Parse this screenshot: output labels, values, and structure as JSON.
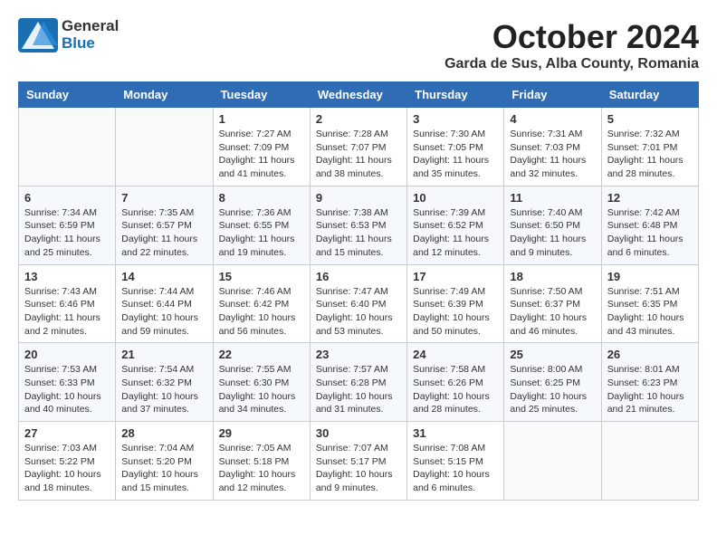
{
  "header": {
    "logo_general": "General",
    "logo_blue": "Blue",
    "month_title": "October 2024",
    "location": "Garda de Sus, Alba County, Romania"
  },
  "days_of_week": [
    "Sunday",
    "Monday",
    "Tuesday",
    "Wednesday",
    "Thursday",
    "Friday",
    "Saturday"
  ],
  "weeks": [
    [
      {
        "day": "",
        "details": ""
      },
      {
        "day": "",
        "details": ""
      },
      {
        "day": "1",
        "details": "Sunrise: 7:27 AM\nSunset: 7:09 PM\nDaylight: 11 hours and 41 minutes."
      },
      {
        "day": "2",
        "details": "Sunrise: 7:28 AM\nSunset: 7:07 PM\nDaylight: 11 hours and 38 minutes."
      },
      {
        "day": "3",
        "details": "Sunrise: 7:30 AM\nSunset: 7:05 PM\nDaylight: 11 hours and 35 minutes."
      },
      {
        "day": "4",
        "details": "Sunrise: 7:31 AM\nSunset: 7:03 PM\nDaylight: 11 hours and 32 minutes."
      },
      {
        "day": "5",
        "details": "Sunrise: 7:32 AM\nSunset: 7:01 PM\nDaylight: 11 hours and 28 minutes."
      }
    ],
    [
      {
        "day": "6",
        "details": "Sunrise: 7:34 AM\nSunset: 6:59 PM\nDaylight: 11 hours and 25 minutes."
      },
      {
        "day": "7",
        "details": "Sunrise: 7:35 AM\nSunset: 6:57 PM\nDaylight: 11 hours and 22 minutes."
      },
      {
        "day": "8",
        "details": "Sunrise: 7:36 AM\nSunset: 6:55 PM\nDaylight: 11 hours and 19 minutes."
      },
      {
        "day": "9",
        "details": "Sunrise: 7:38 AM\nSunset: 6:53 PM\nDaylight: 11 hours and 15 minutes."
      },
      {
        "day": "10",
        "details": "Sunrise: 7:39 AM\nSunset: 6:52 PM\nDaylight: 11 hours and 12 minutes."
      },
      {
        "day": "11",
        "details": "Sunrise: 7:40 AM\nSunset: 6:50 PM\nDaylight: 11 hours and 9 minutes."
      },
      {
        "day": "12",
        "details": "Sunrise: 7:42 AM\nSunset: 6:48 PM\nDaylight: 11 hours and 6 minutes."
      }
    ],
    [
      {
        "day": "13",
        "details": "Sunrise: 7:43 AM\nSunset: 6:46 PM\nDaylight: 11 hours and 2 minutes."
      },
      {
        "day": "14",
        "details": "Sunrise: 7:44 AM\nSunset: 6:44 PM\nDaylight: 10 hours and 59 minutes."
      },
      {
        "day": "15",
        "details": "Sunrise: 7:46 AM\nSunset: 6:42 PM\nDaylight: 10 hours and 56 minutes."
      },
      {
        "day": "16",
        "details": "Sunrise: 7:47 AM\nSunset: 6:40 PM\nDaylight: 10 hours and 53 minutes."
      },
      {
        "day": "17",
        "details": "Sunrise: 7:49 AM\nSunset: 6:39 PM\nDaylight: 10 hours and 50 minutes."
      },
      {
        "day": "18",
        "details": "Sunrise: 7:50 AM\nSunset: 6:37 PM\nDaylight: 10 hours and 46 minutes."
      },
      {
        "day": "19",
        "details": "Sunrise: 7:51 AM\nSunset: 6:35 PM\nDaylight: 10 hours and 43 minutes."
      }
    ],
    [
      {
        "day": "20",
        "details": "Sunrise: 7:53 AM\nSunset: 6:33 PM\nDaylight: 10 hours and 40 minutes."
      },
      {
        "day": "21",
        "details": "Sunrise: 7:54 AM\nSunset: 6:32 PM\nDaylight: 10 hours and 37 minutes."
      },
      {
        "day": "22",
        "details": "Sunrise: 7:55 AM\nSunset: 6:30 PM\nDaylight: 10 hours and 34 minutes."
      },
      {
        "day": "23",
        "details": "Sunrise: 7:57 AM\nSunset: 6:28 PM\nDaylight: 10 hours and 31 minutes."
      },
      {
        "day": "24",
        "details": "Sunrise: 7:58 AM\nSunset: 6:26 PM\nDaylight: 10 hours and 28 minutes."
      },
      {
        "day": "25",
        "details": "Sunrise: 8:00 AM\nSunset: 6:25 PM\nDaylight: 10 hours and 25 minutes."
      },
      {
        "day": "26",
        "details": "Sunrise: 8:01 AM\nSunset: 6:23 PM\nDaylight: 10 hours and 21 minutes."
      }
    ],
    [
      {
        "day": "27",
        "details": "Sunrise: 7:03 AM\nSunset: 5:22 PM\nDaylight: 10 hours and 18 minutes."
      },
      {
        "day": "28",
        "details": "Sunrise: 7:04 AM\nSunset: 5:20 PM\nDaylight: 10 hours and 15 minutes."
      },
      {
        "day": "29",
        "details": "Sunrise: 7:05 AM\nSunset: 5:18 PM\nDaylight: 10 hours and 12 minutes."
      },
      {
        "day": "30",
        "details": "Sunrise: 7:07 AM\nSunset: 5:17 PM\nDaylight: 10 hours and 9 minutes."
      },
      {
        "day": "31",
        "details": "Sunrise: 7:08 AM\nSunset: 5:15 PM\nDaylight: 10 hours and 6 minutes."
      },
      {
        "day": "",
        "details": ""
      },
      {
        "day": "",
        "details": ""
      }
    ]
  ]
}
